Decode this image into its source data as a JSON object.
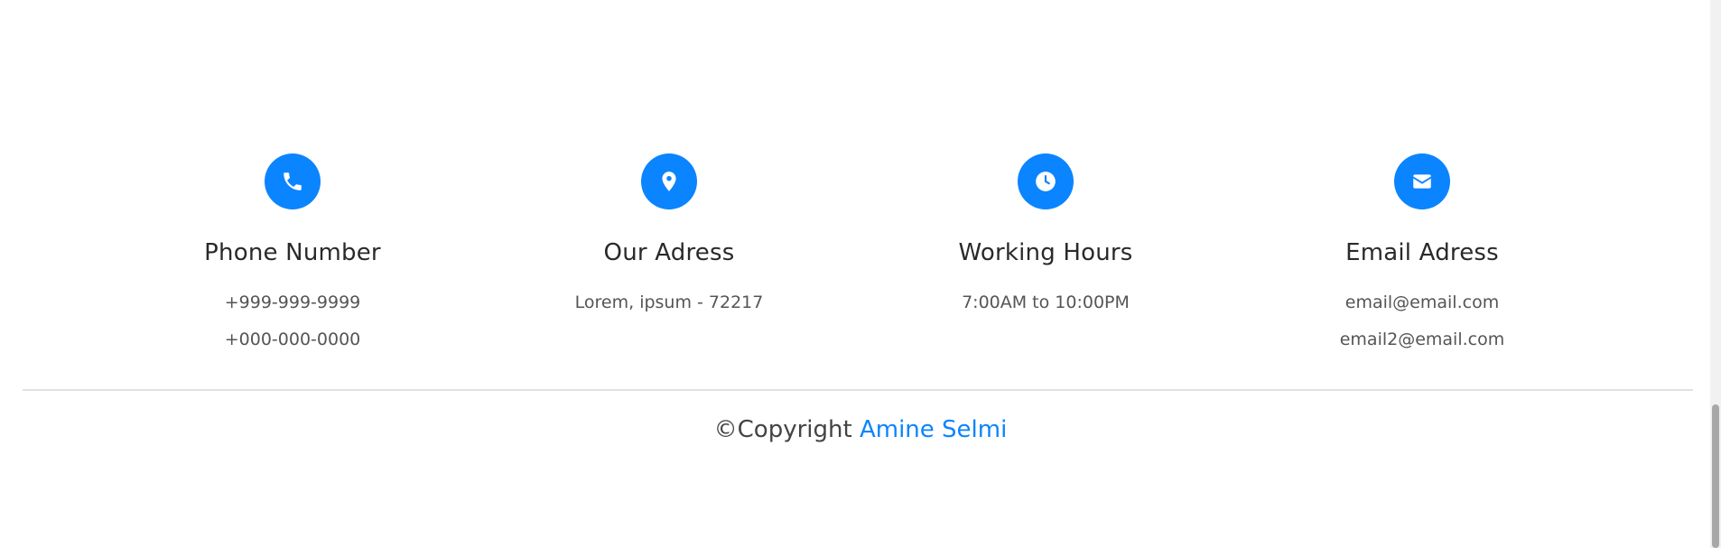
{
  "contact": {
    "items": [
      {
        "icon": "phone-icon",
        "title": "Phone Number",
        "lines": [
          "+999-999-9999",
          "+000-000-0000"
        ]
      },
      {
        "icon": "map-pin-icon",
        "title": "Our Adress",
        "lines": [
          "Lorem, ipsum - 72217"
        ]
      },
      {
        "icon": "clock-icon",
        "title": "Working Hours",
        "lines": [
          "7:00AM to 10:00PM"
        ]
      },
      {
        "icon": "envelope-icon",
        "title": "Email Adress",
        "lines": [
          "email@email.com",
          "email2@email.com"
        ]
      }
    ]
  },
  "copyright": {
    "prefix": "©Copyright",
    "author": "Amine Selmi"
  },
  "colors": {
    "accent": "#0b84ff",
    "heading": "#2a2a2a",
    "text": "#555555",
    "divider": "#e2e2e2"
  }
}
